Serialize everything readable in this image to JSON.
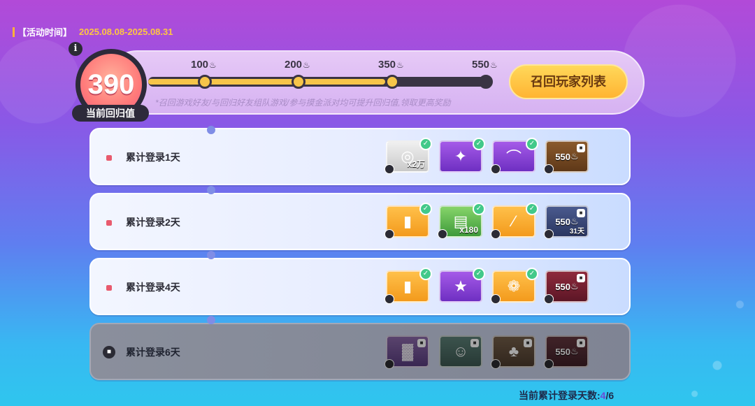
{
  "event": {
    "label": "【活动时间】",
    "dates": "2025.08.08-2025.08.31"
  },
  "progress": {
    "current_value": "390",
    "current_label": "当前回归值",
    "fill_fraction": 0.7,
    "milestones": [
      {
        "value": "100",
        "reached": true
      },
      {
        "value": "200",
        "reached": true
      },
      {
        "value": "350",
        "reached": true
      },
      {
        "value": "550",
        "reached": false
      }
    ],
    "flame_icon": "flame-icon",
    "hint": "*召回游戏好友/与回归好友组队游戏/参与摸金派对均可提升回归值,领取更高奖励",
    "recall_button": "召回玩家列表"
  },
  "days": [
    {
      "title": "累计登录1天",
      "locked": false,
      "rewards": [
        {
          "icon": "coin-icon",
          "color": "gray",
          "qty": "x2万",
          "claimed": true
        },
        {
          "icon": "avatar-frame-icon",
          "color": "purple",
          "claimed": true
        },
        {
          "icon": "scarf-icon",
          "color": "purple",
          "claimed": true
        },
        {
          "icon": "cat-outfit-icon",
          "color": "brown",
          "cost": "550",
          "locked": true
        }
      ]
    },
    {
      "title": "累计登录2天",
      "locked": false,
      "rewards": [
        {
          "icon": "ticket-icon",
          "color": "orange",
          "claimed": true
        },
        {
          "icon": "cash-stack-icon",
          "color": "green",
          "qty": "x180",
          "claimed": true
        },
        {
          "icon": "wand-icon",
          "color": "orange",
          "claimed": true
        },
        {
          "icon": "emblem-icon",
          "color": "navy",
          "cost": "550",
          "sub": "31天",
          "locked": true
        }
      ]
    },
    {
      "title": "累计登录4天",
      "locked": false,
      "rewards": [
        {
          "icon": "ticket-icon",
          "color": "orange",
          "claimed": true
        },
        {
          "icon": "star-crown-icon",
          "color": "purple",
          "claimed": true
        },
        {
          "icon": "polar-bear-icon",
          "color": "orange",
          "claimed": true
        },
        {
          "icon": "cat-outfit-icon",
          "color": "maroon",
          "cost": "550",
          "locked": true
        }
      ]
    },
    {
      "title": "累计登录6天",
      "locked": true,
      "rewards": [
        {
          "icon": "chart-card-icon",
          "color": "purple",
          "locked": true
        },
        {
          "icon": "character-icon",
          "color": "teal",
          "locked": true
        },
        {
          "icon": "frog-icon",
          "color": "brown",
          "locked": true
        },
        {
          "icon": "cat-outfit-icon",
          "color": "maroon",
          "cost": "550",
          "locked": true
        }
      ]
    }
  ],
  "login_count": {
    "label": "当前累计登录天数:",
    "current": "4",
    "total": "/6"
  }
}
